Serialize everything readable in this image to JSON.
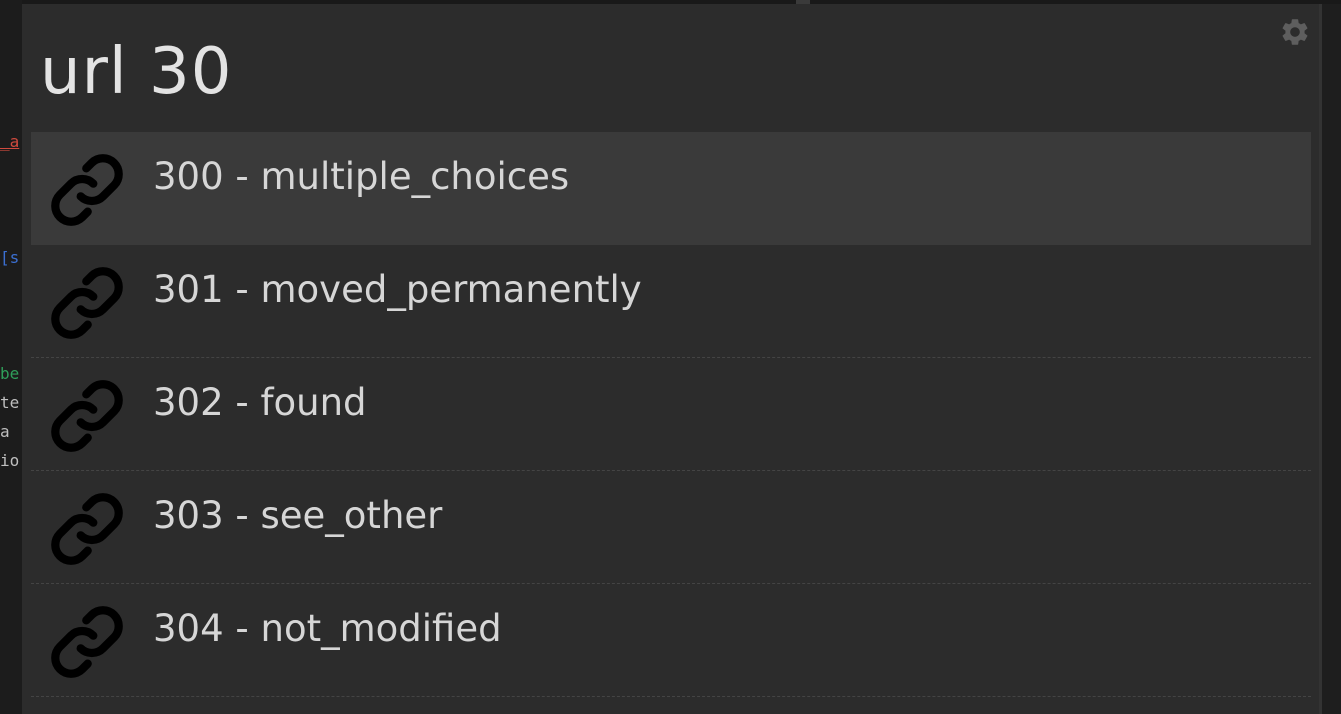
{
  "background_editor": {
    "fragments": [
      {
        "text": "_a",
        "color": "#d04a3e",
        "underline": true
      },
      {
        "text": "[s",
        "color": "#3b6fd1",
        "underline": false
      },
      {
        "text": "be",
        "color": "#2f9e5a",
        "underline": false
      },
      {
        "text": "te",
        "color": "#bfbfbf",
        "underline": false
      },
      {
        "text": " a",
        "color": "#bfbfbf",
        "underline": false
      },
      {
        "text": "io",
        "color": "#bfbfbf",
        "underline": false
      }
    ]
  },
  "launcher": {
    "query": "url 30",
    "settings_icon": "gear-icon",
    "accent_colors": {
      "panel_bg": "#2c2c2c",
      "selected_bg": "#3a3a3a",
      "text": "#d6d6d6"
    },
    "results": [
      {
        "label": "300 - multiple_choices",
        "icon": "link-icon",
        "selected": true
      },
      {
        "label": "301 - moved_permanently",
        "icon": "link-icon",
        "selected": false
      },
      {
        "label": "302 - found",
        "icon": "link-icon",
        "selected": false
      },
      {
        "label": "303 - see_other",
        "icon": "link-icon",
        "selected": false
      },
      {
        "label": "304 - not_modified",
        "icon": "link-icon",
        "selected": false
      }
    ]
  }
}
